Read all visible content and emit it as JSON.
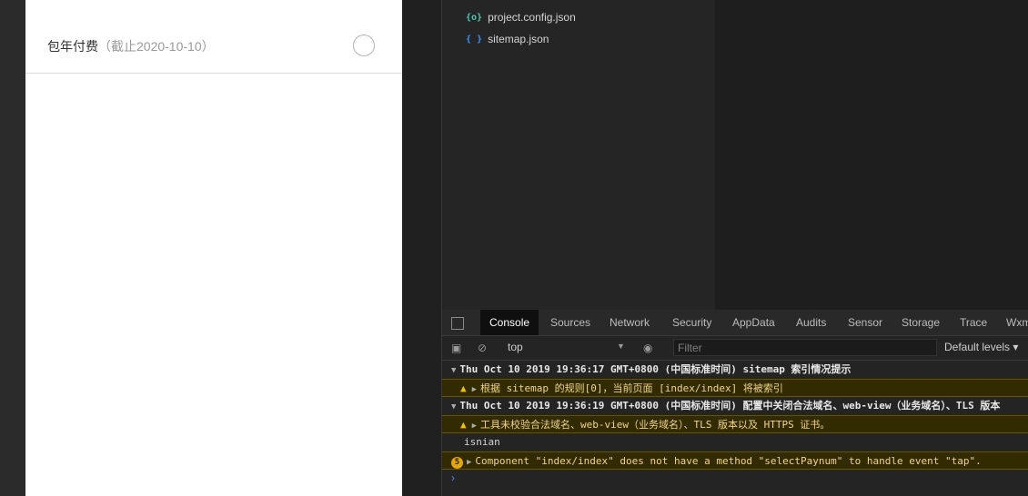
{
  "phone": {
    "pay_option": {
      "title": "包年付费",
      "subtitle": "（截止2020-10-10）"
    }
  },
  "filetree": {
    "files": [
      {
        "icon": "{o}",
        "name": "project.config.json",
        "color": "#4ec9b0"
      },
      {
        "icon": "{ }",
        "name": "sitemap.json",
        "color": "#3794ff"
      }
    ]
  },
  "devtools": {
    "tabs": [
      "Console",
      "Sources",
      "Network",
      "Security",
      "AppData",
      "Audits",
      "Sensor",
      "Storage",
      "Trace",
      "Wxm"
    ],
    "active_tab": "Console",
    "context": "top",
    "filter_placeholder": "Filter",
    "levels": "Default levels",
    "logs": [
      {
        "type": "group",
        "text": "Thu Oct 10 2019 19:36:17 GMT+0800 (中国标准时间) sitemap 索引情况提示"
      },
      {
        "type": "warn",
        "text": "根据 sitemap 的规则[0]，当前页面 [index/index] 将被索引"
      },
      {
        "type": "group",
        "text": "Thu Oct 10 2019 19:36:19 GMT+0800 (中国标准时间) 配置中关闭合法域名、web-view（业务域名）、TLS 版本"
      },
      {
        "type": "warn",
        "text": "工具未校验合法域名、web-view（业务域名）、TLS 版本以及 HTTPS 证书。"
      },
      {
        "type": "plain",
        "text": "isnian"
      },
      {
        "type": "warn-count",
        "count": "5",
        "text": "Component \"index/index\" does not have a method \"selectPaynum\" to handle event \"tap\"."
      }
    ],
    "prompt": "›"
  }
}
